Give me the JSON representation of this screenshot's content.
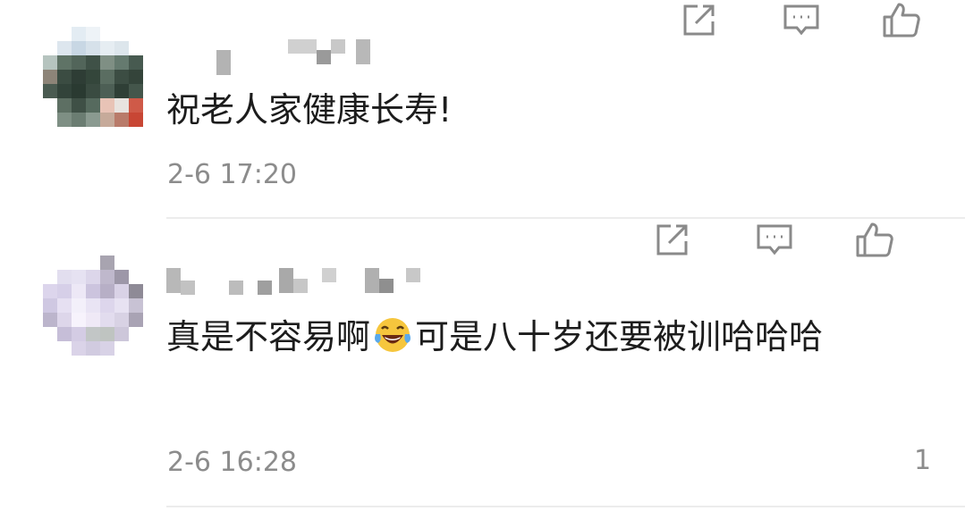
{
  "comments": [
    {
      "text": "祝老人家健康长寿!",
      "time": "2-6 17:20",
      "like_count": ""
    },
    {
      "text_before_emoji": "真是不容易啊",
      "emoji": "laughing-tears",
      "text_after_emoji": "可是八十岁还要被训哈哈哈",
      "time": "2-6 16:28",
      "like_count": "1"
    }
  ],
  "icons": {
    "share": "share-icon",
    "reply": "comment-icon",
    "like": "thumbs-up-icon"
  },
  "colors": {
    "text": "#1c1c1c",
    "meta": "#8c8c8c",
    "icon": "#8a8a8a",
    "divider": "#ececec"
  }
}
